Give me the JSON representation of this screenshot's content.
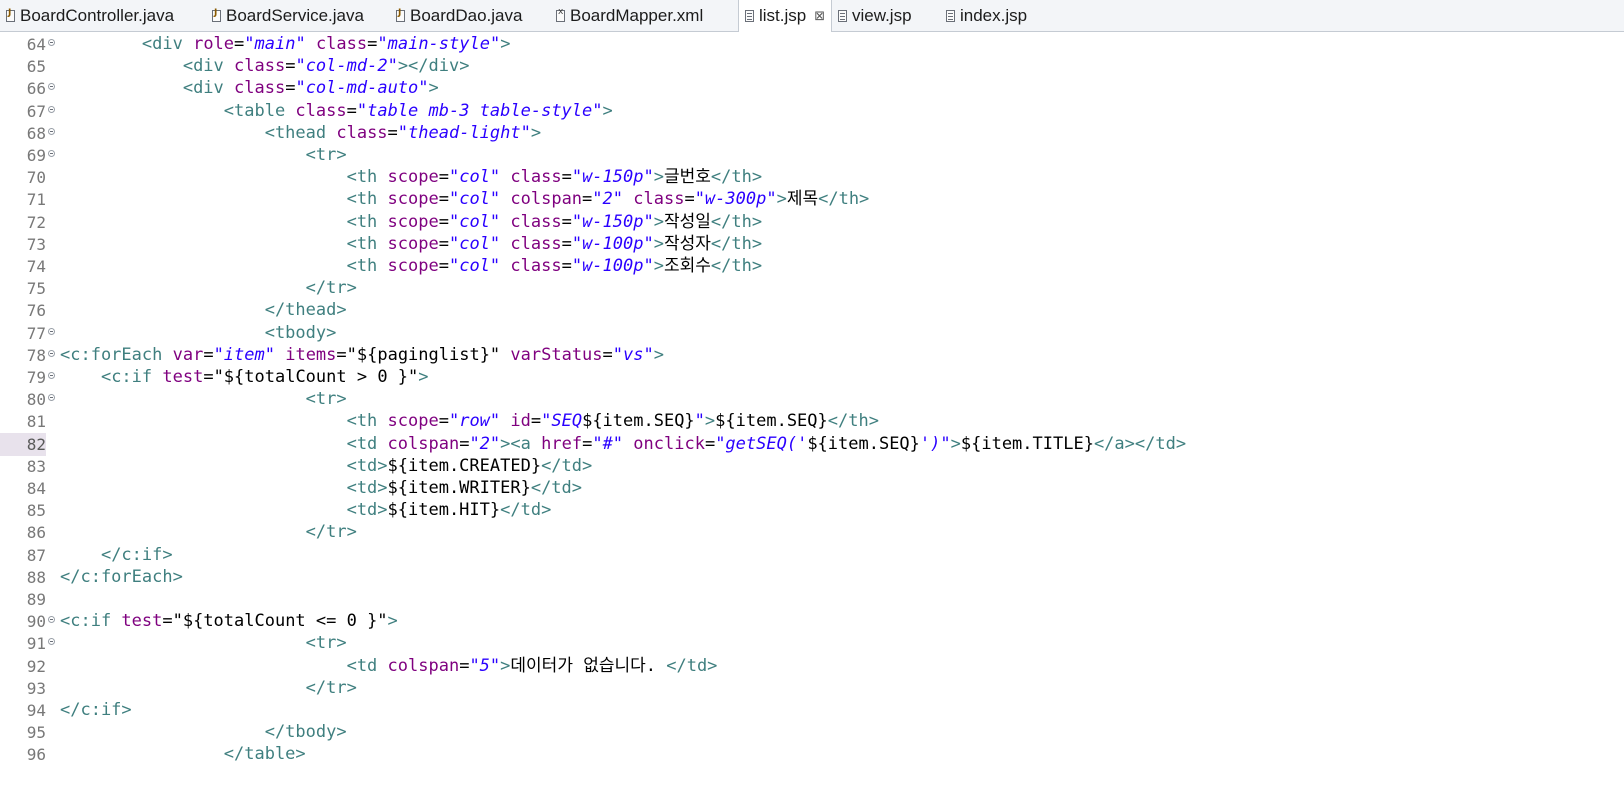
{
  "tabs": [
    {
      "label": "BoardController.java",
      "icon": "java-file-icon",
      "active": false
    },
    {
      "label": "BoardService.java",
      "icon": "java-file-icon",
      "active": false
    },
    {
      "label": "BoardDao.java",
      "icon": "java-file-icon",
      "active": false
    },
    {
      "label": "BoardMapper.xml",
      "icon": "xml-file-icon",
      "active": false
    },
    {
      "label": "list.jsp",
      "icon": "jsp-file-icon",
      "active": true,
      "close": "⊠"
    },
    {
      "label": "view.jsp",
      "icon": "jsp-file-icon",
      "active": false
    },
    {
      "label": "index.jsp",
      "icon": "jsp-file-icon",
      "active": false
    }
  ],
  "colors": {
    "tag": "#3f7f7f",
    "attribute": "#7f007f",
    "value": "#2a00ff",
    "line_number": "#787878",
    "current_line": "#e8e2ec"
  },
  "current_line": 82,
  "lines": [
    {
      "num": "64",
      "fold": true,
      "segs": [
        [
          "",
          "        "
        ],
        [
          "tg",
          "<div "
        ],
        [
          "at",
          "role"
        ],
        [
          "",
          "="
        ],
        [
          "vl",
          "\"main\""
        ],
        [
          "at",
          " class"
        ],
        [
          "",
          "="
        ],
        [
          "vl",
          "\"main-style\""
        ],
        [
          "tg",
          ">"
        ]
      ]
    },
    {
      "num": "65",
      "fold": false,
      "segs": [
        [
          "",
          "            "
        ],
        [
          "tg",
          "<div "
        ],
        [
          "at",
          "class"
        ],
        [
          "",
          "="
        ],
        [
          "vl",
          "\"col-md-2\""
        ],
        [
          "tg",
          "></div>"
        ]
      ]
    },
    {
      "num": "66",
      "fold": true,
      "segs": [
        [
          "",
          "            "
        ],
        [
          "tg",
          "<div "
        ],
        [
          "at",
          "class"
        ],
        [
          "",
          "="
        ],
        [
          "vl",
          "\"col-md-auto\""
        ],
        [
          "tg",
          ">"
        ]
      ]
    },
    {
      "num": "67",
      "fold": true,
      "segs": [
        [
          "",
          "                "
        ],
        [
          "tg",
          "<table "
        ],
        [
          "at",
          "class"
        ],
        [
          "",
          "="
        ],
        [
          "vl",
          "\"table mb-3 table-style\""
        ],
        [
          "tg",
          ">"
        ]
      ]
    },
    {
      "num": "68",
      "fold": true,
      "segs": [
        [
          "",
          "                    "
        ],
        [
          "tg",
          "<thead "
        ],
        [
          "at",
          "class"
        ],
        [
          "",
          "="
        ],
        [
          "vl",
          "\"thead-light\""
        ],
        [
          "tg",
          ">"
        ]
      ]
    },
    {
      "num": "69",
      "fold": true,
      "segs": [
        [
          "",
          "                        "
        ],
        [
          "tg",
          "<tr>"
        ]
      ]
    },
    {
      "num": "70",
      "fold": false,
      "segs": [
        [
          "",
          "                            "
        ],
        [
          "tg",
          "<th "
        ],
        [
          "at",
          "scope"
        ],
        [
          "",
          "="
        ],
        [
          "vl",
          "\"col\""
        ],
        [
          "at",
          " class"
        ],
        [
          "",
          "="
        ],
        [
          "vl",
          "\"w-150p\""
        ],
        [
          "tg",
          ">"
        ],
        [
          "",
          "글번호"
        ],
        [
          "tg",
          "</th>"
        ]
      ]
    },
    {
      "num": "71",
      "fold": false,
      "segs": [
        [
          "",
          "                            "
        ],
        [
          "tg",
          "<th "
        ],
        [
          "at",
          "scope"
        ],
        [
          "",
          "="
        ],
        [
          "vl",
          "\"col\""
        ],
        [
          "at",
          " colspan"
        ],
        [
          "",
          "="
        ],
        [
          "vl",
          "\"2\""
        ],
        [
          "at",
          " class"
        ],
        [
          "",
          "="
        ],
        [
          "vl",
          "\"w-300p\""
        ],
        [
          "tg",
          ">"
        ],
        [
          "",
          "제목"
        ],
        [
          "tg",
          "</th>"
        ]
      ]
    },
    {
      "num": "72",
      "fold": false,
      "segs": [
        [
          "",
          "                            "
        ],
        [
          "tg",
          "<th "
        ],
        [
          "at",
          "scope"
        ],
        [
          "",
          "="
        ],
        [
          "vl",
          "\"col\""
        ],
        [
          "at",
          " class"
        ],
        [
          "",
          "="
        ],
        [
          "vl",
          "\"w-150p\""
        ],
        [
          "tg",
          ">"
        ],
        [
          "",
          "작성일"
        ],
        [
          "tg",
          "</th>"
        ]
      ]
    },
    {
      "num": "73",
      "fold": false,
      "segs": [
        [
          "",
          "                            "
        ],
        [
          "tg",
          "<th "
        ],
        [
          "at",
          "scope"
        ],
        [
          "",
          "="
        ],
        [
          "vl",
          "\"col\""
        ],
        [
          "at",
          " class"
        ],
        [
          "",
          "="
        ],
        [
          "vl",
          "\"w-100p\""
        ],
        [
          "tg",
          ">"
        ],
        [
          "",
          "작성자"
        ],
        [
          "tg",
          "</th>"
        ]
      ]
    },
    {
      "num": "74",
      "fold": false,
      "segs": [
        [
          "",
          "                            "
        ],
        [
          "tg",
          "<th "
        ],
        [
          "at",
          "scope"
        ],
        [
          "",
          "="
        ],
        [
          "vl",
          "\"col\""
        ],
        [
          "at",
          " class"
        ],
        [
          "",
          "="
        ],
        [
          "vl",
          "\"w-100p\""
        ],
        [
          "tg",
          ">"
        ],
        [
          "",
          "조회수"
        ],
        [
          "tg",
          "</th>"
        ]
      ]
    },
    {
      "num": "75",
      "fold": false,
      "segs": [
        [
          "",
          "                        "
        ],
        [
          "tg",
          "</tr>"
        ]
      ]
    },
    {
      "num": "76",
      "fold": false,
      "segs": [
        [
          "",
          "                    "
        ],
        [
          "tg",
          "</thead>"
        ]
      ]
    },
    {
      "num": "77",
      "fold": true,
      "segs": [
        [
          "",
          "                    "
        ],
        [
          "tg",
          "<tbody>"
        ]
      ]
    },
    {
      "num": "78",
      "fold": true,
      "segs": [
        [
          "tg",
          "<c:forEach "
        ],
        [
          "at",
          "var"
        ],
        [
          "",
          "="
        ],
        [
          "vl",
          "\"item\""
        ],
        [
          "at",
          " items"
        ],
        [
          "",
          "=\"${paginglist}\""
        ],
        [
          "at",
          " varStatus"
        ],
        [
          "",
          "="
        ],
        [
          "vl",
          "\"vs\""
        ],
        [
          "tg",
          ">"
        ]
      ]
    },
    {
      "num": "79",
      "fold": true,
      "segs": [
        [
          "",
          "    "
        ],
        [
          "tg",
          "<c:if "
        ],
        [
          "at",
          "test"
        ],
        [
          "",
          "=\"${totalCount > 0 }\""
        ],
        [
          "tg",
          ">"
        ]
      ]
    },
    {
      "num": "80",
      "fold": true,
      "segs": [
        [
          "",
          "                        "
        ],
        [
          "tg",
          "<tr>"
        ]
      ]
    },
    {
      "num": "81",
      "fold": false,
      "segs": [
        [
          "",
          "                            "
        ],
        [
          "tg",
          "<th "
        ],
        [
          "at",
          "scope"
        ],
        [
          "",
          "="
        ],
        [
          "vl",
          "\"row\""
        ],
        [
          "at",
          " id"
        ],
        [
          "",
          "="
        ],
        [
          "vl",
          "\"SEQ"
        ],
        [
          "",
          "${item.SEQ}"
        ],
        [
          "vl",
          "\""
        ],
        [
          "tg",
          ">"
        ],
        [
          "",
          "${item.SEQ}"
        ],
        [
          "tg",
          "</th>"
        ]
      ]
    },
    {
      "num": "82",
      "fold": false,
      "segs": [
        [
          "",
          "                            "
        ],
        [
          "tg",
          "<td "
        ],
        [
          "at",
          "colspan"
        ],
        [
          "",
          "="
        ],
        [
          "vl",
          "\"2\""
        ],
        [
          "tg",
          ">"
        ],
        [
          "tg",
          "<a "
        ],
        [
          "at",
          "href"
        ],
        [
          "",
          "="
        ],
        [
          "vl",
          "\"#\""
        ],
        [
          "at",
          " onclick"
        ],
        [
          "",
          "="
        ],
        [
          "vl",
          "\"getSEQ('"
        ],
        [
          "",
          "${item.SEQ}"
        ],
        [
          "vl",
          "')\""
        ],
        [
          "tg",
          ">"
        ],
        [
          "",
          "${item.TITLE}"
        ],
        [
          "tg",
          "</a></td>"
        ]
      ]
    },
    {
      "num": "83",
      "fold": false,
      "segs": [
        [
          "",
          "                            "
        ],
        [
          "tg",
          "<td>"
        ],
        [
          "",
          "${item.CREATED}"
        ],
        [
          "tg",
          "</td>"
        ]
      ]
    },
    {
      "num": "84",
      "fold": false,
      "segs": [
        [
          "",
          "                            "
        ],
        [
          "tg",
          "<td>"
        ],
        [
          "",
          "${item.WRITER}"
        ],
        [
          "tg",
          "</td>"
        ]
      ]
    },
    {
      "num": "85",
      "fold": false,
      "segs": [
        [
          "",
          "                            "
        ],
        [
          "tg",
          "<td>"
        ],
        [
          "",
          "${item.HIT}"
        ],
        [
          "tg",
          "</td>"
        ]
      ]
    },
    {
      "num": "86",
      "fold": false,
      "segs": [
        [
          "",
          "                        "
        ],
        [
          "tg",
          "</tr>"
        ]
      ]
    },
    {
      "num": "87",
      "fold": false,
      "segs": [
        [
          "",
          "    "
        ],
        [
          "tg",
          "</c:if>"
        ]
      ]
    },
    {
      "num": "88",
      "fold": false,
      "segs": [
        [
          "tg",
          "</c:forEach>"
        ]
      ]
    },
    {
      "num": "89",
      "fold": false,
      "segs": []
    },
    {
      "num": "90",
      "fold": true,
      "segs": [
        [
          "tg",
          "<c:if "
        ],
        [
          "at",
          "test"
        ],
        [
          "",
          "=\"${totalCount <= 0 }\""
        ],
        [
          "tg",
          ">"
        ]
      ]
    },
    {
      "num": "91",
      "fold": true,
      "segs": [
        [
          "",
          "                        "
        ],
        [
          "tg",
          "<tr>"
        ]
      ]
    },
    {
      "num": "92",
      "fold": false,
      "segs": [
        [
          "",
          "                            "
        ],
        [
          "tg",
          "<td "
        ],
        [
          "at",
          "colspan"
        ],
        [
          "",
          "="
        ],
        [
          "vl",
          "\"5\""
        ],
        [
          "tg",
          ">"
        ],
        [
          "",
          "데이터가 없습니다. "
        ],
        [
          "tg",
          "</td>"
        ]
      ]
    },
    {
      "num": "93",
      "fold": false,
      "segs": [
        [
          "",
          "                        "
        ],
        [
          "tg",
          "</tr>"
        ]
      ]
    },
    {
      "num": "94",
      "fold": false,
      "segs": [
        [
          "tg",
          "</c:if>"
        ]
      ]
    },
    {
      "num": "95",
      "fold": false,
      "segs": [
        [
          "",
          "                    "
        ],
        [
          "tg",
          "</tbody>"
        ]
      ]
    },
    {
      "num": "96",
      "fold": false,
      "segs": [
        [
          "",
          "                "
        ],
        [
          "tg",
          "</table>"
        ]
      ]
    }
  ]
}
